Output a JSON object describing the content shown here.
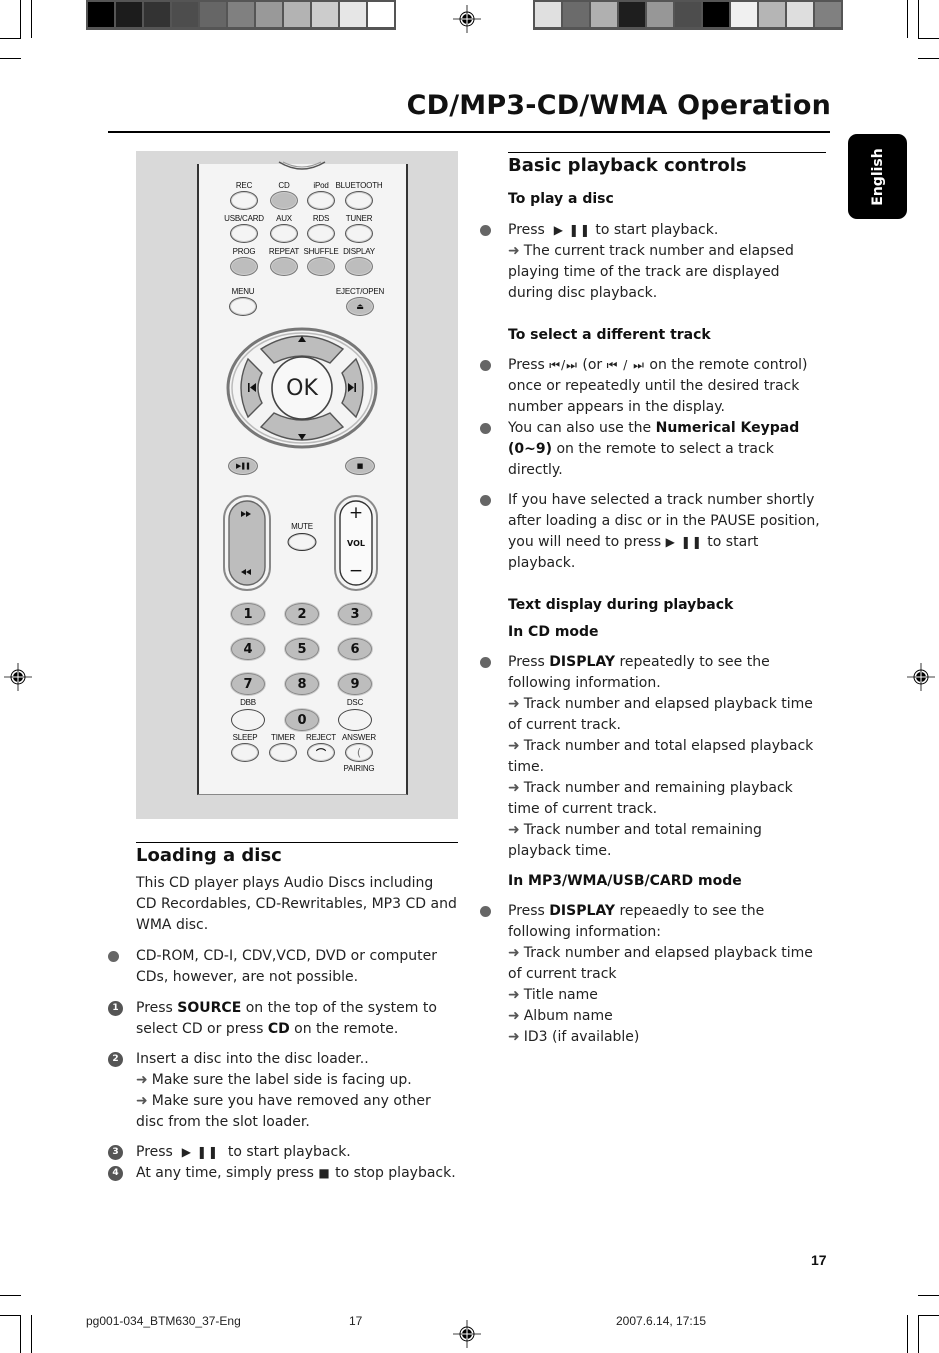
{
  "header": {
    "title": "CD/MP3-CD/WMA Operation",
    "language_tab": "English"
  },
  "print_marks": {
    "swatches_left": [
      "#000000",
      "#1c1c1c",
      "#333333",
      "#4d4d4d",
      "#666666",
      "#808080",
      "#999999",
      "#b3b3b3",
      "#cccccc",
      "#e6e6e6",
      "#ffffff"
    ],
    "swatches_right": [
      "#e0e0e0",
      "#6b6b6b",
      "#b0b0b0",
      "#1e1e1e",
      "#979797",
      "#4d4d4d",
      "#000000",
      "#f0f0f0",
      "#b5b5b5",
      "#dedede",
      "#808080"
    ]
  },
  "remote": {
    "row1": [
      {
        "label": "REC",
        "style": "white"
      },
      {
        "label": "CD",
        "style": "grey"
      },
      {
        "label": "iPod",
        "style": "white"
      },
      {
        "label": "BLUETOOTH",
        "style": "white"
      }
    ],
    "row2": [
      {
        "label": "USB/CARD",
        "style": "white"
      },
      {
        "label": "AUX",
        "style": "white"
      },
      {
        "label": "RDS",
        "style": "white"
      },
      {
        "label": "TUNER",
        "style": "white"
      }
    ],
    "row3": [
      {
        "label": "PROG",
        "style": "grey"
      },
      {
        "label": "REPEAT",
        "style": "grey"
      },
      {
        "label": "SHUFFLE",
        "style": "grey"
      },
      {
        "label": "DISPLAY",
        "style": "grey"
      }
    ],
    "menu_label": "MENU",
    "eject_label": "EJECT/OPEN",
    "ok_label": "OK",
    "mute_label": "MUTE",
    "vol_label": "VOL",
    "vol_plus": "+",
    "vol_minus": "−",
    "keypad": [
      "1",
      "2",
      "3",
      "4",
      "5",
      "6",
      "7",
      "8",
      "9",
      "0"
    ],
    "dbb_label": "DBB",
    "dsc_label": "DSC",
    "bottom_row": [
      "SLEEP",
      "TIMER",
      "REJECT",
      "ANSWER"
    ],
    "pairing_label": "PAIRING"
  },
  "loading": {
    "heading": "Loading a disc",
    "intro": "This CD player plays Audio Discs including CD Recordables, CD-Rewritables, MP3 CD and WMA disc.",
    "note": "CD-ROM, CD-I, CDV,VCD, DVD or computer CDs, however, are not possible.",
    "step1_a": "Press ",
    "step1_b": "SOURCE",
    "step1_c": " on the top of the system to select CD or press ",
    "step1_d": "CD",
    "step1_e": " on the remote.",
    "step2": "Insert a disc into the disc loader..",
    "step2_sub1": "Make sure the label side is facing up.",
    "step2_sub2": "Make sure you have removed any other disc from the slot loader.",
    "step3_a": "Press",
    "step3_sym": "▶ ❚❚",
    "step3_b": " to start playback.",
    "step4_a": "At any time, simply press ",
    "step4_sym": "■",
    "step4_b": " to stop playback.",
    "step_numbers": [
      "1",
      "2",
      "3",
      "4"
    ]
  },
  "basic": {
    "heading": "Basic playback controls",
    "play_heading": "To play a disc",
    "play_a": "Press ",
    "play_sym": "▶ ❚❚",
    "play_b": " to start playback.",
    "play_sub": "The current track number and elapsed playing time of the track are displayed during disc playback.",
    "select_heading": "To select a different track",
    "select_a": "Press ",
    "select_sym1": "⏮/⏭",
    "select_b": " (or ",
    "select_sym2": "⏮ / ⏭",
    "select_c": " on the remote control) once or repeatedly until the desired track number appears in the display.",
    "keypad_a": "You can also use the ",
    "keypad_b": "Numerical Keypad (0~9)",
    "keypad_c": " on the remote to select a track directly.",
    "pause_a": "If you have selected a track number shortly after loading a disc or in the PAUSE position, you will need to press ",
    "pause_sym": "▶ ❚❚",
    "pause_b": " to start playback.",
    "textdisp_heading": "Text display during playback",
    "cd_mode_heading": "In CD mode",
    "cd_a": "Press ",
    "cd_b": "DISPLAY",
    "cd_c": " repeatedly to see the following information.",
    "cd_items": [
      "Track number and elapsed playback time of current track.",
      "Track number and total elapsed playback time.",
      "Track number and remaining playback time of current track.",
      "Track number and total remaining playback time."
    ],
    "mp3_mode_heading": "In MP3/WMA/USB/CARD mode",
    "mp3_a": "Press ",
    "mp3_b": "DISPLAY",
    "mp3_c": " repeaedly to see the following information:",
    "mp3_items": [
      "Track number and elapsed playback time of current track",
      "Title name",
      "Album name",
      "ID3 (if available)"
    ],
    "arrow": "➜"
  },
  "footer": {
    "page_number": "17",
    "file": "pg001-034_BTM630_37-Eng",
    "page": "17",
    "date": "2007.6.14, 17:15"
  }
}
